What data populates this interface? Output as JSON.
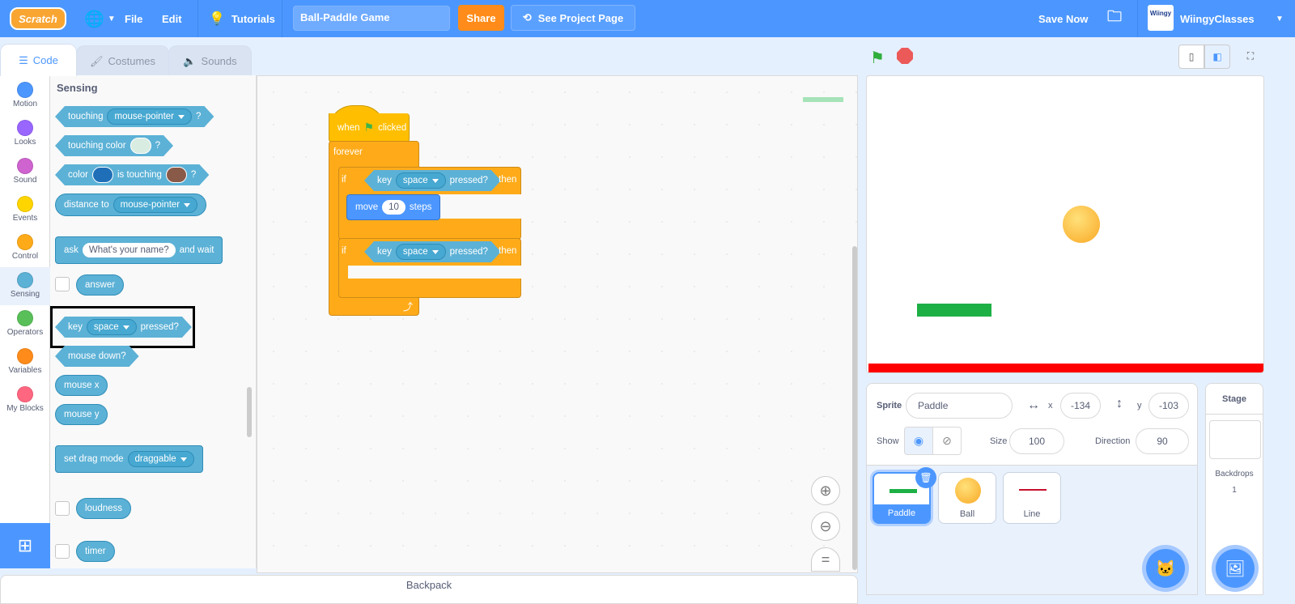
{
  "topbar": {
    "logo": "Scratch",
    "globe_icon": "globe-icon",
    "menu_file": "File",
    "menu_edit": "Edit",
    "tutorials": "Tutorials",
    "project_title": "Ball-Paddle Game",
    "share": "Share",
    "see_project_page": "See Project Page",
    "save_now": "Save Now",
    "username": "WiingyClasses",
    "avatar_text": "Wiingy"
  },
  "tabs": [
    {
      "label": "Code",
      "active": true
    },
    {
      "label": "Costumes",
      "active": false
    },
    {
      "label": "Sounds",
      "active": false
    }
  ],
  "categories": [
    {
      "label": "Motion",
      "color": "#4c97ff"
    },
    {
      "label": "Looks",
      "color": "#9966ff"
    },
    {
      "label": "Sound",
      "color": "#cf63cf"
    },
    {
      "label": "Events",
      "color": "#ffd500"
    },
    {
      "label": "Control",
      "color": "#ffab19"
    },
    {
      "label": "Sensing",
      "color": "#5cb1d6"
    },
    {
      "label": "Operators",
      "color": "#59c059"
    },
    {
      "label": "Variables",
      "color": "#ff8c1a"
    },
    {
      "label": "My Blocks",
      "color": "#ff6680"
    }
  ],
  "palette": {
    "heading": "Sensing",
    "touching": {
      "label": "touching",
      "option": "mouse-pointer",
      "q": "?"
    },
    "touching_color": {
      "label": "touching color",
      "q": "?",
      "color": "#d9ece1"
    },
    "color_touching": {
      "label": "color",
      "mid": "is touching",
      "q": "?",
      "color1": "#1f6fb8",
      "color2": "#8a5a48"
    },
    "distance_to": {
      "label": "distance to",
      "option": "mouse-pointer"
    },
    "ask": {
      "label": "ask",
      "value": "What's your name?",
      "suffix": "and wait"
    },
    "answer": "answer",
    "key_pressed": {
      "label": "key",
      "option": "space",
      "suffix": "pressed?"
    },
    "mouse_down": "mouse down?",
    "mouse_x": "mouse x",
    "mouse_y": "mouse y",
    "drag_mode": {
      "label": "set drag mode",
      "option": "draggable"
    },
    "loudness": "loudness",
    "timer": "timer"
  },
  "script": {
    "hat": {
      "when": "when",
      "clicked": "clicked"
    },
    "forever": "forever",
    "if1": {
      "if": "if",
      "key": "key",
      "option": "space",
      "pressed": "pressed?",
      "then": "then"
    },
    "move": {
      "label": "move",
      "value": "10",
      "suffix": "steps"
    },
    "if2": {
      "if": "if",
      "key": "key",
      "option": "space",
      "pressed": "pressed?",
      "then": "then"
    }
  },
  "backpack": "Backpack",
  "sprite_info": {
    "sprite_label": "Sprite",
    "sprite_name": "Paddle",
    "x_label": "x",
    "x": "-134",
    "y_label": "y",
    "y": "-103",
    "show_label": "Show",
    "size_label": "Size",
    "size": "100",
    "direction_label": "Direction",
    "direction": "90"
  },
  "sprites": [
    {
      "name": "Paddle",
      "selected": true
    },
    {
      "name": "Ball",
      "selected": false
    },
    {
      "name": "Line",
      "selected": false
    }
  ],
  "stage_panel": {
    "title": "Stage",
    "backdrops_label": "Backdrops",
    "backdrops_count": "1"
  },
  "colors": {
    "accent": "#4c97ff",
    "sensing": "#5cb1d6",
    "control": "#ffab19",
    "motion": "#4c97ff",
    "share": "#ff8c1a",
    "paddle": "#1db045",
    "ball": "#f9b52c",
    "line": "#ff0000"
  }
}
